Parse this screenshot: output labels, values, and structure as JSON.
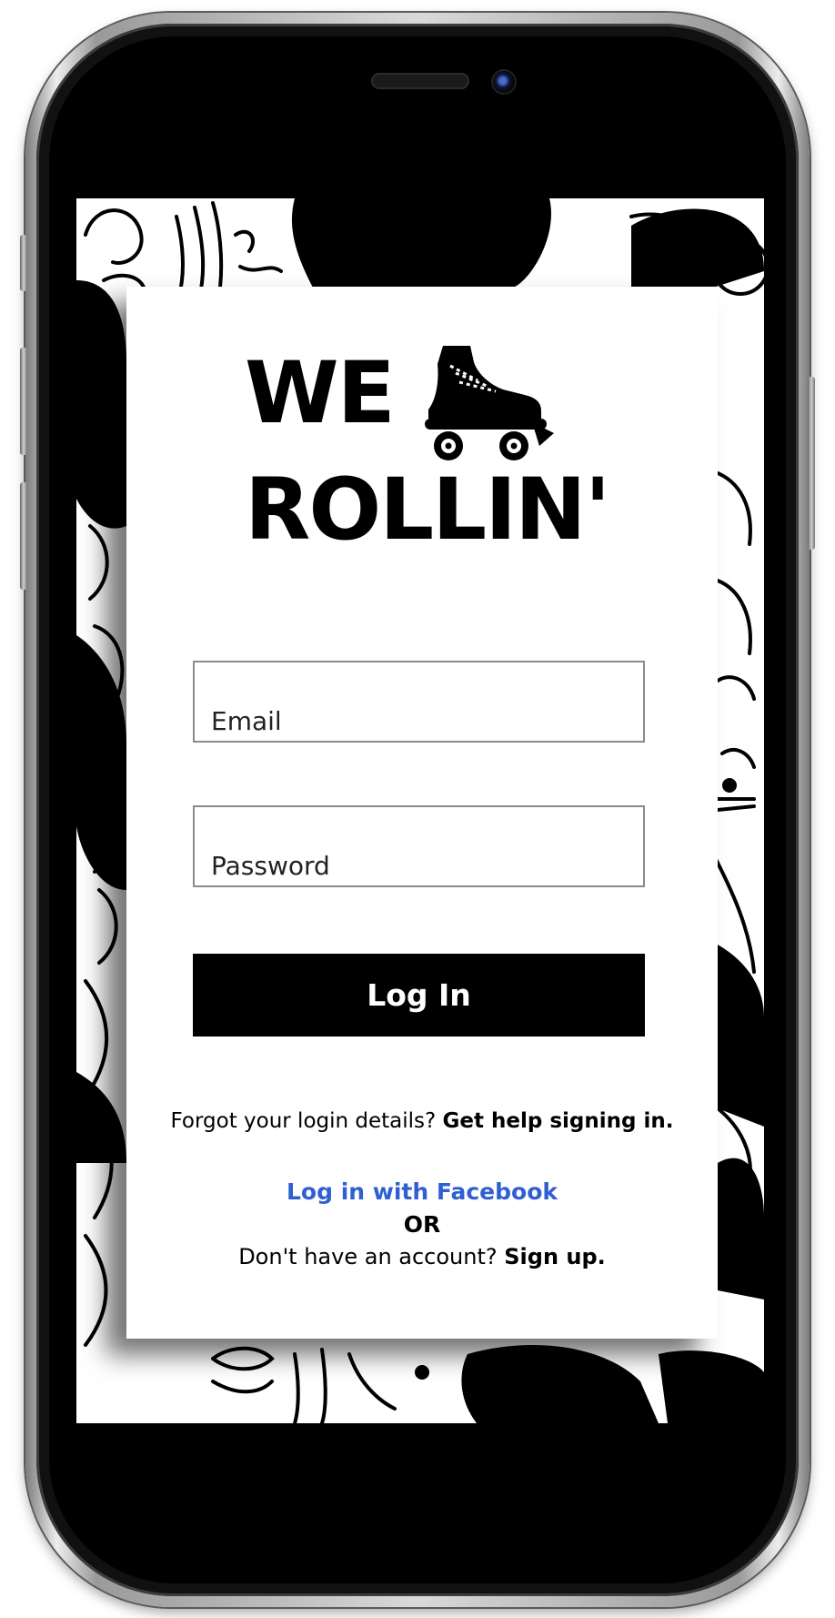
{
  "app": {
    "brand_line1": "WE",
    "brand_line2": "ROLLIN'",
    "brand_icon": "roller-skate-icon"
  },
  "form": {
    "email_placeholder": "Email",
    "password_placeholder": "Password",
    "login_label": "Log In"
  },
  "help": {
    "forgot_text": "Forgot your login details?",
    "forgot_link": "Get help signing in."
  },
  "social": {
    "facebook_label": "Log in with Facebook",
    "facebook_color": "#2f5fd0"
  },
  "signup": {
    "or_text": "OR",
    "prompt": "Don't have an account?",
    "link": "Sign up."
  },
  "colors": {
    "primary_button": "#000000",
    "background": "#ffffff"
  }
}
